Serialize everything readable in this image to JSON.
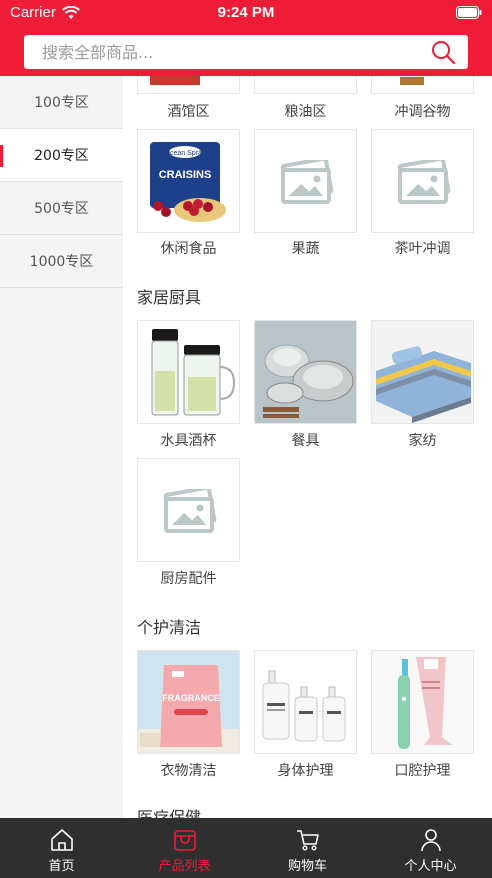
{
  "status_bar": {
    "carrier": "Carrier",
    "time": "9:24 PM"
  },
  "search": {
    "placeholder": "搜索全部商品..."
  },
  "sidebar": {
    "items": [
      {
        "label": "100专区"
      },
      {
        "label": "200专区"
      },
      {
        "label": "500专区"
      },
      {
        "label": "1000专区"
      }
    ],
    "active_index": 1
  },
  "top_row": {
    "labels": [
      "酒馆区",
      "粮油区",
      "冲调谷物"
    ]
  },
  "food_row": {
    "labels": [
      "休闲食品",
      "果蔬",
      "茶叶冲调"
    ]
  },
  "home_section": {
    "title": "家居厨具",
    "labels": [
      "水具酒杯",
      "餐具",
      "家纺",
      "厨房配件"
    ]
  },
  "care_section": {
    "title": "个护清洁",
    "labels": [
      "衣物清洁",
      "身体护理",
      "口腔护理"
    ]
  },
  "health_section": {
    "title": "医疗保健"
  },
  "raisin_brand": "Ocean Spray",
  "raisin_name": "CRAISINS",
  "detergent_name": "FRAGRANCE",
  "tabbar": {
    "items": [
      {
        "label": "首页"
      },
      {
        "label": "产品列表"
      },
      {
        "label": "购物车"
      },
      {
        "label": "个人中心"
      }
    ]
  },
  "colors": {
    "brand_red": "#ee1c37",
    "tabbar_bg": "#2f2f2f"
  }
}
